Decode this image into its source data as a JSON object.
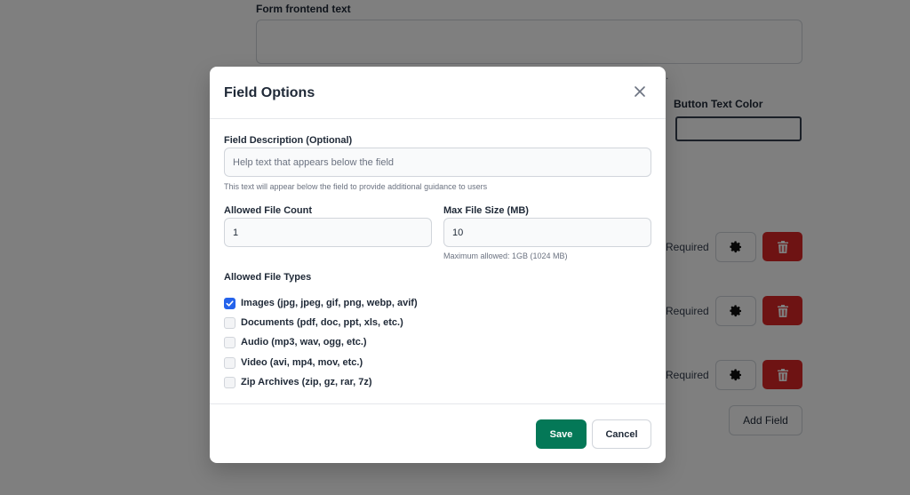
{
  "background": {
    "form_frontend_text_label": "Form frontend text",
    "trailing_dot": ".",
    "button_text_color_label": "Button Text Color",
    "rows": [
      {
        "required_label": "Required"
      },
      {
        "required_label": "Required"
      },
      {
        "required_label": "Required"
      }
    ],
    "add_field_label": "Add Field",
    "colors": {
      "delete": "#dc2626"
    }
  },
  "modal": {
    "title": "Field Options",
    "close_icon": "close-icon",
    "description": {
      "label": "Field Description (Optional)",
      "value": "",
      "placeholder": "Help text that appears below the field",
      "hint": "This text will appear below the field to provide additional guidance to users"
    },
    "file_count": {
      "label": "Allowed File Count",
      "value": "1"
    },
    "max_size": {
      "label": "Max File Size (MB)",
      "value": "10",
      "hint": "Maximum allowed: 1GB (1024 MB)"
    },
    "file_types": {
      "label": "Allowed File Types",
      "options": [
        {
          "label": "Images (jpg, jpeg, gif, png, webp, avif)",
          "checked": true
        },
        {
          "label": "Documents (pdf, doc, ppt, xls, etc.)",
          "checked": false
        },
        {
          "label": "Audio (mp3, wav, ogg, etc.)",
          "checked": false
        },
        {
          "label": "Video (avi, mp4, mov, etc.)",
          "checked": false
        },
        {
          "label": "Zip Archives (zip, gz, rar, 7z)",
          "checked": false
        }
      ]
    },
    "footer": {
      "save_label": "Save",
      "cancel_label": "Cancel",
      "save_color": "#047857",
      "checkbox_color": "#2563eb"
    }
  }
}
